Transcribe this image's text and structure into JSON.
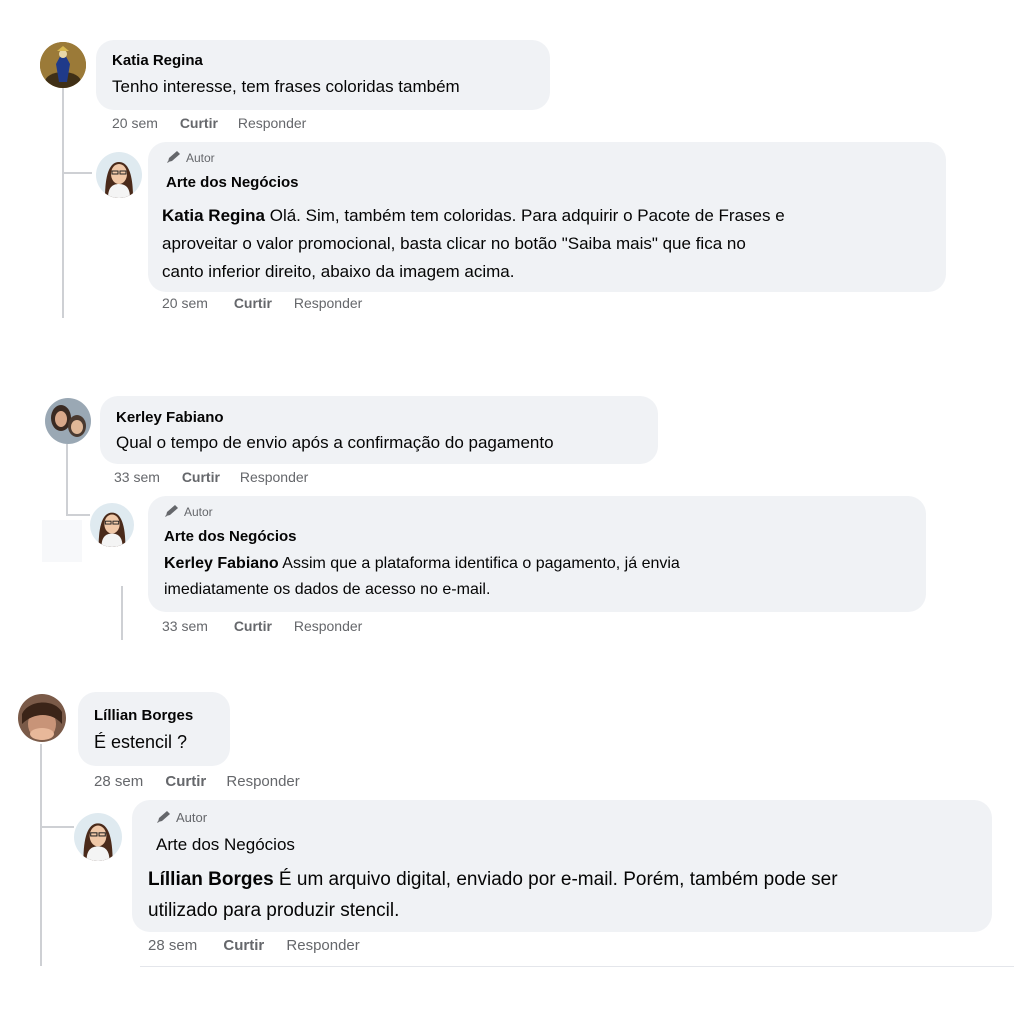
{
  "threads": [
    {
      "comment": {
        "author": "Katia Regina",
        "text": "Tenho interesse, tem frases coloridas também",
        "time": "20 sem",
        "like": "Curtir",
        "reply": "Responder"
      },
      "reply": {
        "author_badge": "Autor",
        "author": "Arte dos Negócios",
        "mention": "Katia Regina",
        "text_line1": "Olá. Sim, também tem coloridas. Para adquirir o Pacote de Frases e",
        "text_line2": "aproveitar o valor promocional, basta clicar no botão \"Saiba mais\" que fica no",
        "text_line3": "canto inferior direito, abaixo da imagem acima.",
        "time": "20 sem",
        "like": "Curtir",
        "reply": "Responder"
      }
    },
    {
      "comment": {
        "author": "Kerley Fabiano",
        "text": "Qual o tempo de envio após a confirmação do pagamento",
        "time": "33 sem",
        "like": "Curtir",
        "reply": "Responder"
      },
      "reply": {
        "author_badge": "Autor",
        "author": "Arte dos Negócios",
        "mention": "Kerley Fabiano",
        "text_line1": "Assim que a plataforma identifica o pagamento, já envia",
        "text_line2": "imediatamente os dados de acesso no e-mail.",
        "time": "33 sem",
        "like": "Curtir",
        "reply": "Responder"
      }
    },
    {
      "comment": {
        "author": "Líllian Borges",
        "text": "É estencil ?",
        "time": "28 sem",
        "like": "Curtir",
        "reply": "Responder"
      },
      "reply": {
        "author_badge": "Autor",
        "author": "Arte dos Negócios",
        "mention": "Líllian Borges",
        "text_line1": "É um arquivo digital, enviado por e-mail. Porém, também pode ser",
        "text_line2": "utilizado para produzir stencil.",
        "time": "28 sem",
        "like": "Curtir",
        "reply": "Responder"
      }
    }
  ]
}
